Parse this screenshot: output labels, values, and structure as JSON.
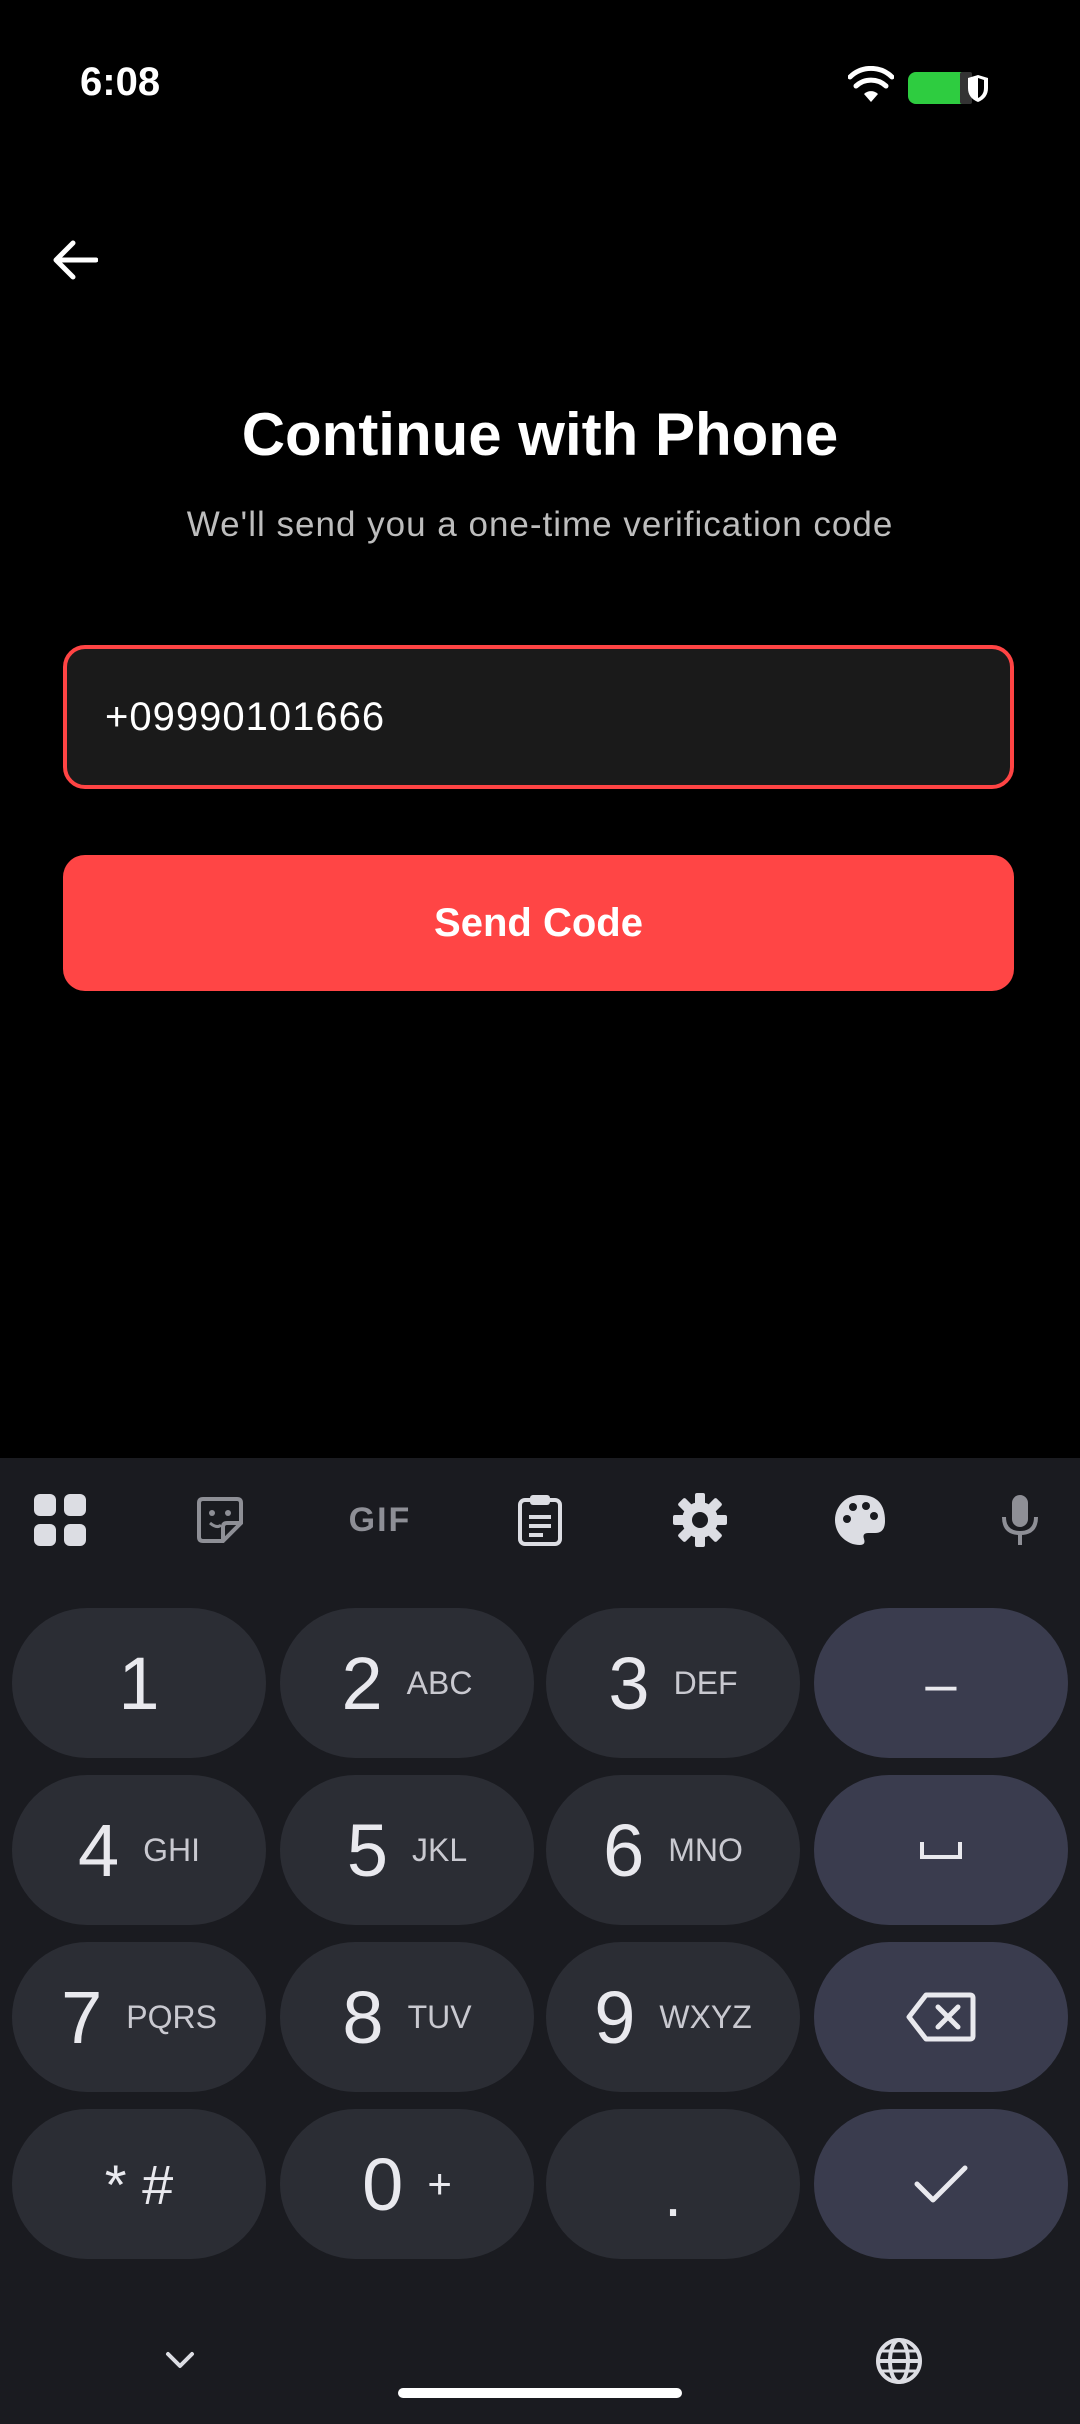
{
  "status_bar": {
    "time": "6:08"
  },
  "screen": {
    "title": "Continue with Phone",
    "subtitle": "We'll send you a one-time verification code",
    "phone_value": "+09990101666",
    "send_button": "Send Code"
  },
  "colors": {
    "accent": "#ff4545",
    "background": "#000000",
    "keyboard_bg": "#1a1b20"
  },
  "keyboard": {
    "toolbar_icons": [
      "apps-grid-icon",
      "sticker-icon",
      "gif-icon",
      "clipboard-icon",
      "settings-gear-icon",
      "palette-icon",
      "microphone-icon"
    ],
    "gif_label": "GIF",
    "keys": [
      {
        "digit": "1",
        "letters": ""
      },
      {
        "digit": "2",
        "letters": "ABC"
      },
      {
        "digit": "3",
        "letters": "DEF"
      },
      {
        "digit": "4",
        "letters": "GHI"
      },
      {
        "digit": "5",
        "letters": "JKL"
      },
      {
        "digit": "6",
        "letters": "MNO"
      },
      {
        "digit": "7",
        "letters": "PQRS"
      },
      {
        "digit": "8",
        "letters": "TUV"
      },
      {
        "digit": "9",
        "letters": "WXYZ"
      },
      {
        "digit": "* #",
        "letters": ""
      },
      {
        "digit": "0",
        "letters": "+"
      },
      {
        "digit": ".",
        "letters": ""
      }
    ],
    "dash_key": "–",
    "space_key": "␣"
  }
}
